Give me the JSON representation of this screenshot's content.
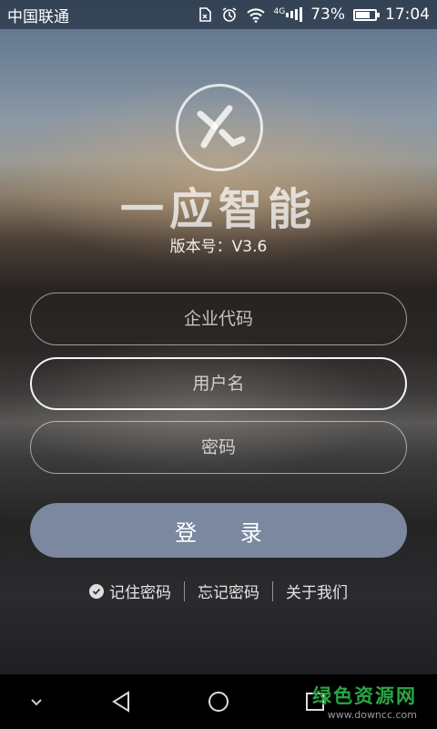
{
  "status_bar": {
    "carrier": "中国联通",
    "network": "4G",
    "battery": "73%",
    "battery_level": 0.73,
    "time": "17:04",
    "icons": [
      "sim-icon",
      "alarm-icon",
      "wifi-icon",
      "signal-icon",
      "battery-icon"
    ]
  },
  "app": {
    "name": "一应智能",
    "version": "版本号：V3.6"
  },
  "form": {
    "company_code_placeholder": "企业代码",
    "username_placeholder": "用户名",
    "password_placeholder": "密码",
    "login_label": "登 录"
  },
  "links": {
    "remember_password": "记住密码",
    "forgot_password": "忘记密码",
    "about_us": "关于我们"
  },
  "nav": {
    "icons": [
      "chevron-down-icon",
      "back-icon",
      "home-icon",
      "recents-icon"
    ]
  },
  "watermark": {
    "main": "绿色资源网",
    "sub": "www.downcc.com"
  },
  "colors": {
    "login_button": "#7b88a0",
    "watermark": "#2aa645"
  }
}
